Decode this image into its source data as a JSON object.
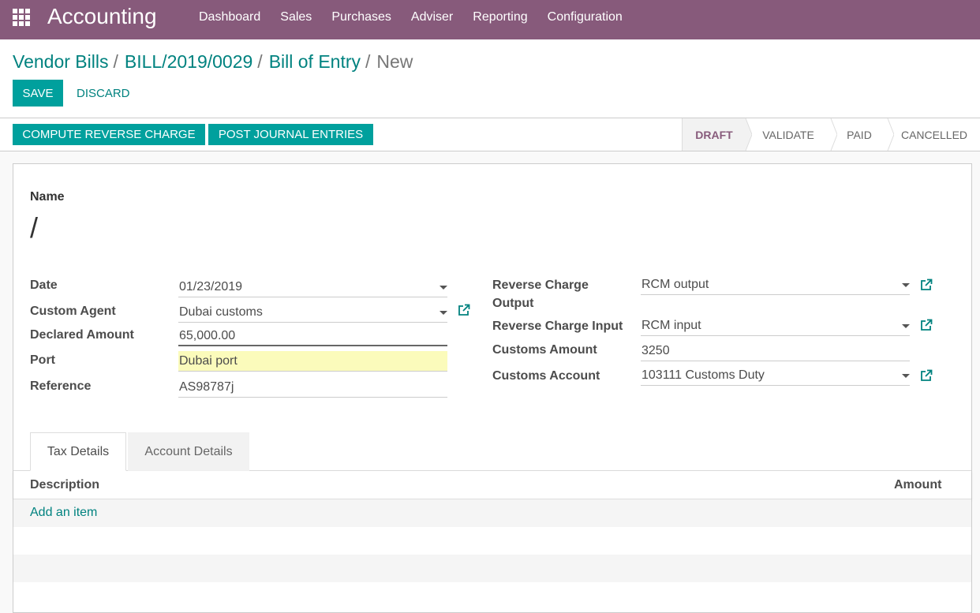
{
  "app": {
    "title": "Accounting",
    "menu": [
      "Dashboard",
      "Sales",
      "Purchases",
      "Adviser",
      "Reporting",
      "Configuration"
    ]
  },
  "breadcrumb": {
    "items": [
      "Vendor Bills",
      "BILL/2019/0029",
      "Bill of Entry"
    ],
    "current": "New",
    "separator": "/"
  },
  "actions": {
    "save_label": "SAVE",
    "discard_label": "DISCARD"
  },
  "statusbar": {
    "compute_label": "COMPUTE REVERSE CHARGE",
    "post_label": "POST JOURNAL ENTRIES",
    "stages": [
      "DRAFT",
      "VALIDATE",
      "PAID",
      "CANCELLED"
    ],
    "active_stage": "DRAFT"
  },
  "form": {
    "name_label": "Name",
    "name_value": "/",
    "left": {
      "date_label": "Date",
      "date_value": "01/23/2019",
      "agent_label": "Custom Agent",
      "agent_value": "Dubai customs",
      "declared_label": "Declared Amount",
      "declared_value": "65,000.00",
      "port_label": "Port",
      "port_value": "Dubai port",
      "reference_label": "Reference",
      "reference_value": "AS98787j"
    },
    "right": {
      "rc_output_label_1": "Reverse Charge",
      "rc_output_label_2": "Output",
      "rc_output_value": "RCM output",
      "rc_input_label": "Reverse Charge Input",
      "rc_input_value": "RCM input",
      "customs_amount_label": "Customs Amount",
      "customs_amount_value": "3250",
      "customs_account_label": "Customs Account",
      "customs_account_value": "103111 Customs Duty"
    }
  },
  "tabs": {
    "active": "Tax Details",
    "inactive": "Account Details"
  },
  "table": {
    "col_description": "Description",
    "col_amount": "Amount",
    "add_item": "Add an item"
  },
  "colors": {
    "navbar": "#875a7b",
    "primary": "#00a09d",
    "link": "#00827f",
    "required": "#fbfbbb"
  }
}
